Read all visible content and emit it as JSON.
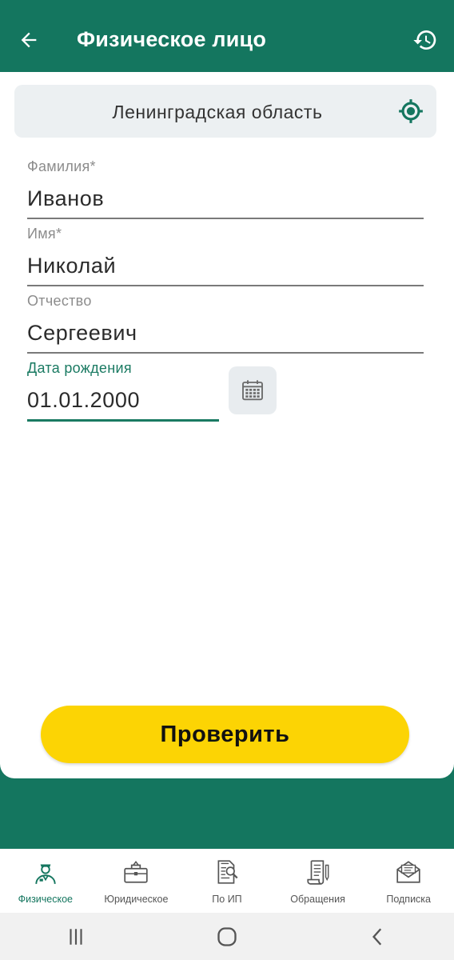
{
  "header": {
    "title": "Физическое лицо",
    "back_icon": "arrow-left-icon",
    "history_icon": "history-icon"
  },
  "region": {
    "value": "Ленинградская область",
    "icon": "location-target-icon"
  },
  "form": {
    "surname": {
      "label": "Фамилия*",
      "value": "Иванов"
    },
    "name": {
      "label": "Имя*",
      "value": "Николай"
    },
    "patronymic": {
      "label": "Отчество",
      "value": "Сергеевич"
    },
    "birth_date": {
      "label": "Дата рождения",
      "value": "01.01.2000",
      "icon": "calendar-icon"
    }
  },
  "submit": {
    "label": "Проверить"
  },
  "nav": {
    "items": [
      {
        "label": "Физическое",
        "icon": "person-icon",
        "active": true
      },
      {
        "label": "Юридическое",
        "icon": "briefcase-icon",
        "active": false
      },
      {
        "label": "По ИП",
        "icon": "document-search-icon",
        "active": false
      },
      {
        "label": "Обращения",
        "icon": "scroll-icon",
        "active": false
      },
      {
        "label": "Подписка",
        "icon": "envelope-icon",
        "active": false
      }
    ]
  },
  "colors": {
    "primary": "#14765f",
    "accent": "#fcd404",
    "field_bg": "#ecf0f2"
  }
}
